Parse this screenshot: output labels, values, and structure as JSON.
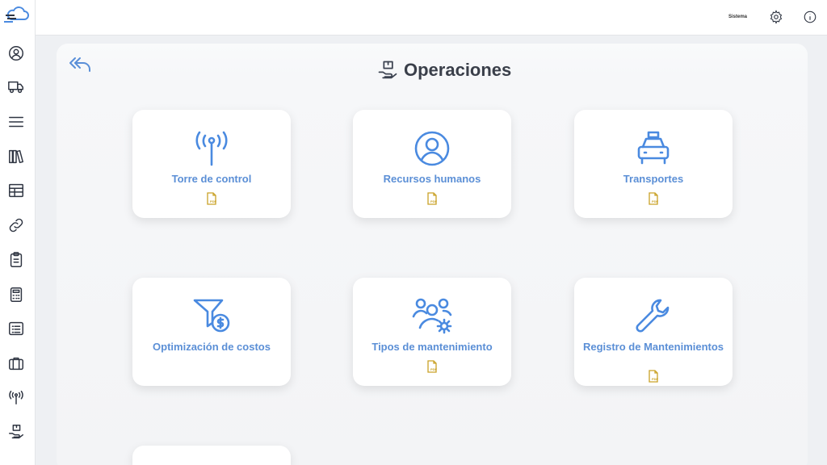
{
  "page": {
    "title": "Operaciones"
  },
  "header": {
    "brand_text": "Sistema"
  },
  "cards": [
    {
      "label": "Torre de control",
      "icon": "antenna-icon",
      "has_pdf": true
    },
    {
      "label": "Recursos humanos",
      "icon": "user-circle-icon",
      "has_pdf": true
    },
    {
      "label": "Transportes",
      "icon": "taxi-icon",
      "has_pdf": true
    },
    {
      "label": "Optimización de costos",
      "icon": "filter-dollar-icon",
      "has_pdf": false
    },
    {
      "label": "Tipos de mantenimiento",
      "icon": "users-gear-icon",
      "has_pdf": true
    },
    {
      "label": "Registro de Mantenimientos",
      "icon": "wrench-icon",
      "has_pdf": true
    }
  ],
  "pdf_label": "PDF",
  "sidebar": {
    "icons": [
      "user-circle-icon",
      "truck-icon",
      "menu-icon",
      "books-icon",
      "table-icon",
      "link-icon",
      "clipboard-icon",
      "calculator-icon",
      "list-icon",
      "briefcase-icon",
      "antenna-icon",
      "hand-box-icon"
    ]
  },
  "colors": {
    "accent": "#4a8ae0",
    "label": "#5b8fd6",
    "pdf": "#c9a227"
  }
}
